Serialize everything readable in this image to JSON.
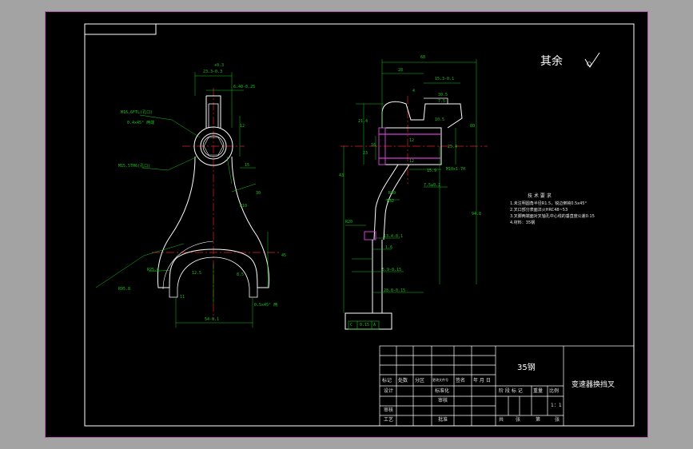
{
  "roughness": {
    "label": "其余"
  },
  "tech_notes": {
    "title": "技 术 要 求",
    "lines": [
      "1.未注明圆角半径R1.5，锐边倒钝0.5x45°",
      "2.叉口部分表面淬火HRC48~53",
      "3.叉脚两端面对叉轴孔中心线的垂直度公差0.15",
      "4.材料：35钢"
    ]
  },
  "dims": {
    "top_width": "23.3-0.3",
    "top_dev": "+0.3",
    "shaft_hole": "6.40-0.25",
    "thread_note": "M16.6FTL(孔口)",
    "chamfer_note": "0.4x45° 两端",
    "bore_note": "M15.5TH6(孔口)",
    "arm_12": "12",
    "arm_15": "15",
    "arm_30": "30",
    "radius_r95": "R95.8",
    "r10": "R10",
    "fork_12_5": "12.5",
    "fork_8_5": "8.5",
    "fork_11": "11",
    "fork_45": "45",
    "fork_r25": "R25.0",
    "fork_chamfer": "0.5x45° 两",
    "fork_gap": "54-0.1",
    "side_68": "68",
    "side_28": "28",
    "side_15_3": "15.3-0.1",
    "side_4": "4",
    "side_30_5": "30.5",
    "side_7_5": "7.5",
    "side_10_5": "10.5",
    "side_21_4": "21.4",
    "side_23": "23",
    "side_12": "12",
    "side_16": "16",
    "side_12b": "12",
    "side_15_9": "15.9",
    "side_m10": "M10x1-7H",
    "side_7_5b": "7.5±0.1",
    "side_43": "43",
    "side_25_4": "25.4",
    "side_R32": "R32",
    "side_R30": "R30",
    "side_R20": "R20",
    "side_80": "80",
    "side_94_8": "94.8",
    "side_13_4": "13.4-0.1",
    "side_1_6": "1.6",
    "side_5_9": "5.9-0.15",
    "side_28_8": "28.8-0.15",
    "tolerance_val": "0.15",
    "tolerance_ref": "A",
    "datum_c": "C"
  },
  "title_block": {
    "material": "35钢",
    "part_name": "变速器换挡叉",
    "header_row": [
      "标记",
      "处数",
      "分区",
      "更改文件号",
      "签名",
      "年 月 日"
    ],
    "row_design": "设计",
    "row_std": "标准化",
    "row_review": "审核",
    "row_process": "工艺",
    "row_check": "审核",
    "row_approve": "批准",
    "stage_headers": [
      "阶 段 标 记",
      "重量",
      "比例"
    ],
    "scale": "1：1",
    "sheet_info": [
      "共",
      "张",
      "第",
      "张"
    ]
  },
  "colors": {
    "background": "#000000",
    "frame": "#ffffff",
    "border": "#b05ab0",
    "outline": "#ffffff",
    "centerline": "#e02020",
    "dimension": "#18c418",
    "hatch": "#d040d0"
  }
}
